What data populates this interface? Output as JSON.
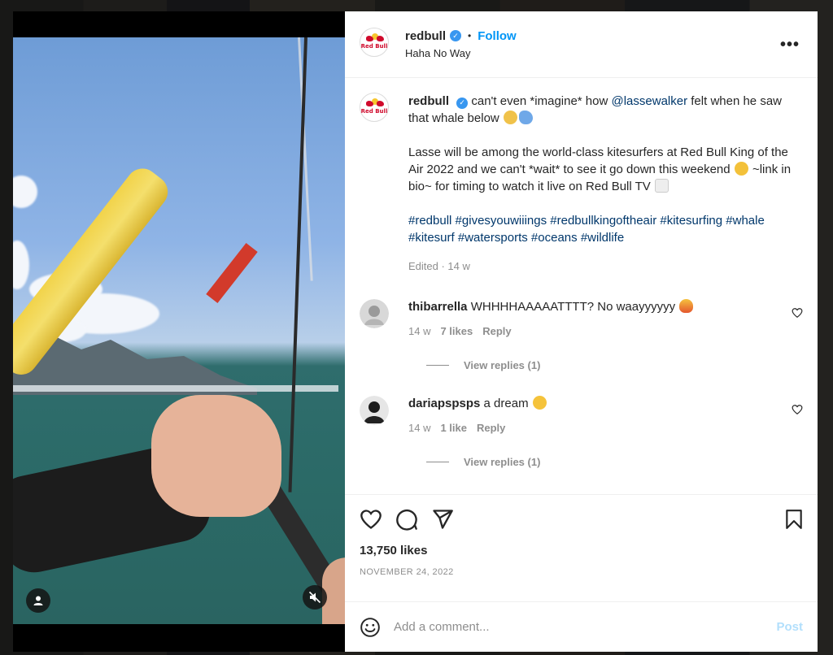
{
  "post": {
    "author": "redbull",
    "subtitle": "Haha No Way",
    "follow_label": "Follow",
    "dot": "•",
    "more": "•••",
    "avatar_text": "Red Bull"
  },
  "caption": {
    "author": "redbull",
    "text1": "can't even *imagine* how ",
    "mention": "@lassewalker",
    "text2": " felt when he saw that whale below",
    "para2": "Lasse will be among the world-class kitesurfers at Red Bull King of the Air 2022 and we can't *wait* to see it go down this weekend",
    "para2b": " ~link in bio~ for timing to watch it live on Red Bull TV",
    "hashtags": [
      "#redbull",
      "#givesyouwiiings",
      "#redbullkingoftheair",
      "#kitesurfing",
      "#whale",
      "#kitesurf",
      "#watersports",
      "#oceans",
      "#wildlife"
    ],
    "meta": "Edited · 14 w"
  },
  "comments": [
    {
      "user": "thibarrella",
      "text": "WHHHHAAAAATTTT? No waayyyyyy",
      "time": "14 w",
      "likes": "7 likes",
      "reply": "Reply",
      "view_replies": "View replies (1)"
    },
    {
      "user": "dariapspsps",
      "text": "a dream",
      "time": "14 w",
      "likes": "1 like",
      "reply": "Reply",
      "view_replies": "View replies (1)"
    }
  ],
  "footer": {
    "likes": "13,750 likes",
    "date": "NOVEMBER 24, 2022",
    "comment_placeholder": "Add a comment...",
    "post_label": "Post"
  },
  "colors": {
    "accent": "#0095f6",
    "verified": "#3897f0",
    "link": "#00376b",
    "muted": "#8e8e8e",
    "post_disabled": "#b2dffc"
  }
}
